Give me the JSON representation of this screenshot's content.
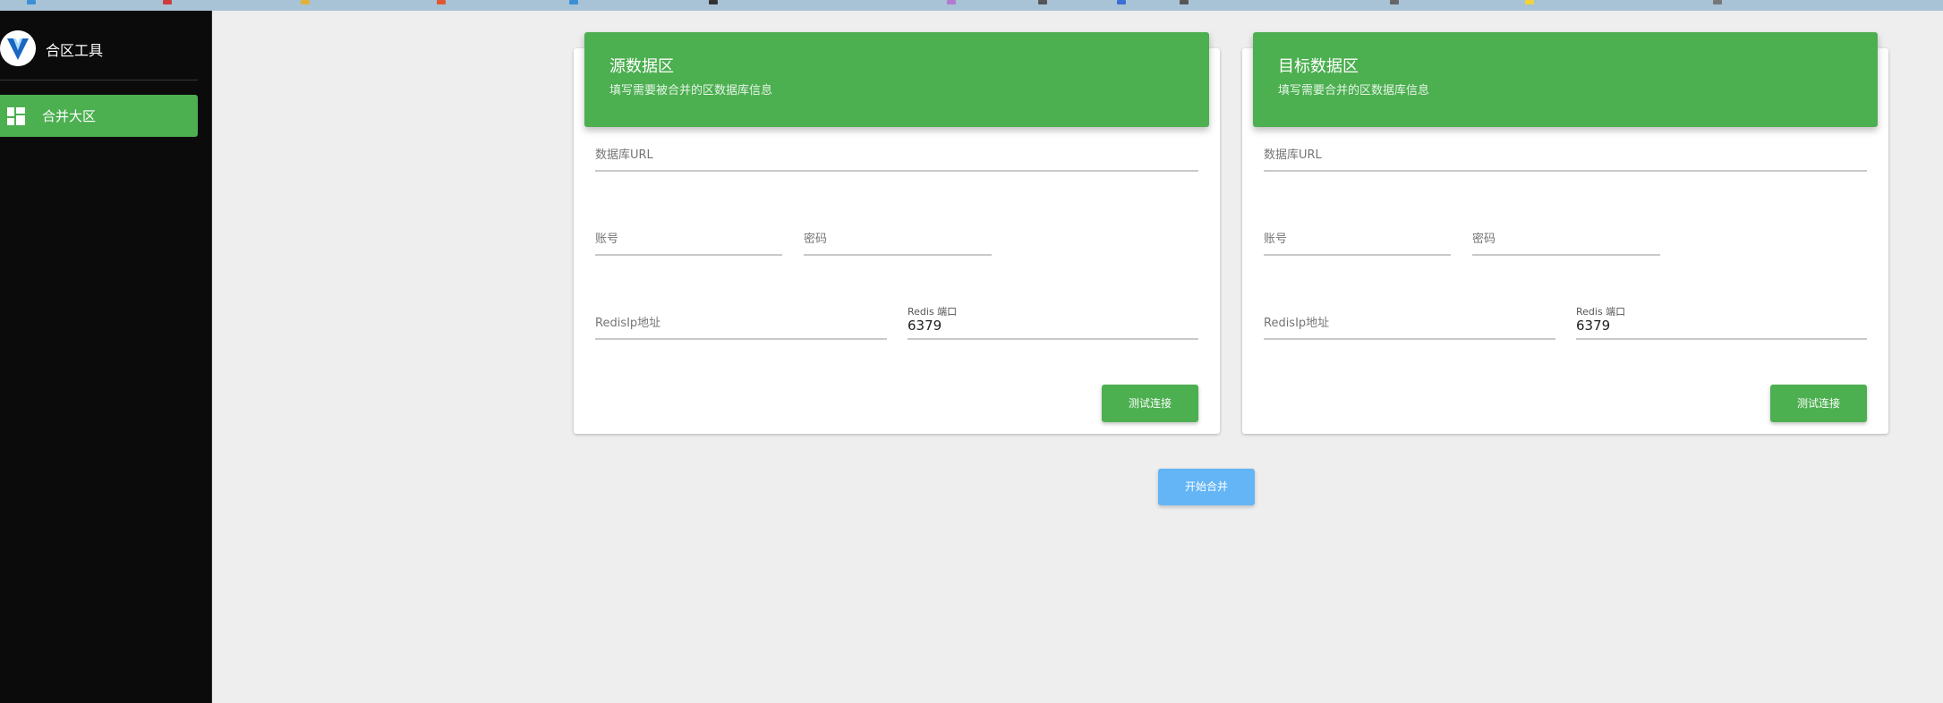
{
  "app": {
    "title": "合区工具",
    "logo_icon": "vuetify-logo-icon"
  },
  "sidebar": {
    "items": [
      {
        "label": "合并大区",
        "icon": "dashboard-icon",
        "active": true
      }
    ]
  },
  "cards": [
    {
      "title": "源数据区",
      "subtitle": "填写需要被合并的区数据库信息",
      "db_url_placeholder": "数据库URL",
      "account_placeholder": "账号",
      "password_placeholder": "密码",
      "redis_ip_placeholder": "RedisIp地址",
      "redis_port_label": "Redis 端口",
      "redis_port_value": "6379",
      "test_button": "测试连接"
    },
    {
      "title": "目标数据区",
      "subtitle": "填写需要合并的区数据库信息",
      "db_url_placeholder": "数据库URL",
      "account_placeholder": "账号",
      "password_placeholder": "密码",
      "redis_ip_placeholder": "RedisIp地址",
      "redis_port_label": "Redis 端口",
      "redis_port_value": "6379",
      "test_button": "测试连接"
    }
  ],
  "actions": {
    "merge_button": "开始合并"
  },
  "colors": {
    "primary": "#4caf50",
    "merge_button": "#64b5f6",
    "sidebar_bg": "#0b0b0b",
    "page_bg": "#eeeeee"
  }
}
